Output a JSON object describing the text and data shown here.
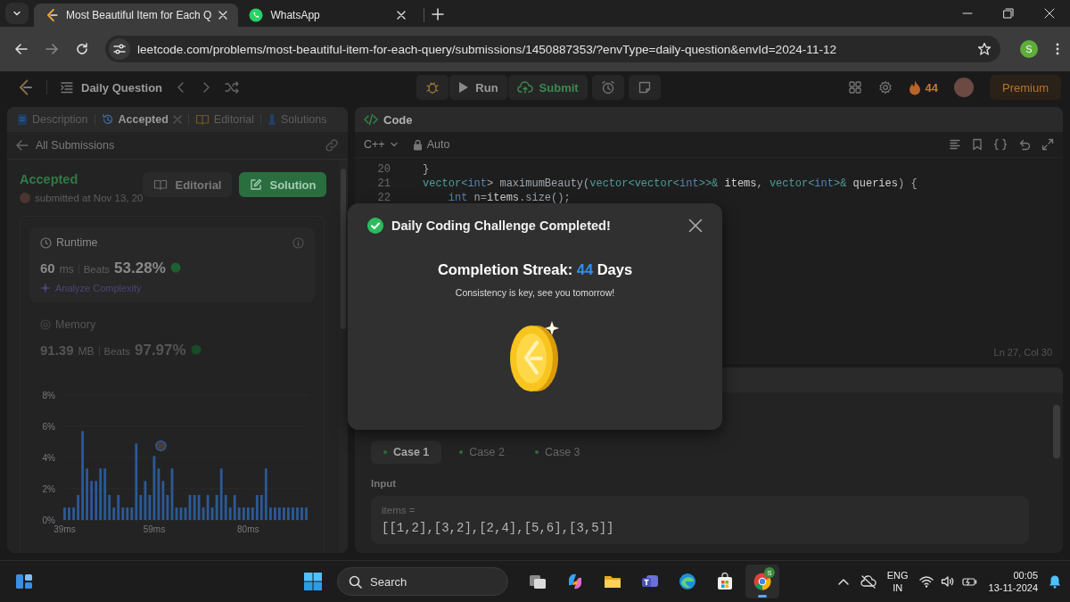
{
  "browser": {
    "tabs": [
      {
        "title": "Most Beautiful Item for Each Q",
        "kind": "leetcode",
        "selected": true
      },
      {
        "title": "WhatsApp",
        "kind": "chat",
        "selected": false
      }
    ],
    "url": "leetcode.com/problems/most-beautiful-item-for-each-query/submissions/1450887353/?envType=daily-question&envId=2024-11-12",
    "profile_initial": "S"
  },
  "nav": {
    "daily_question": "Daily Question",
    "run": "Run",
    "submit": "Submit",
    "streak": "44",
    "premium": "Premium"
  },
  "left_panel": {
    "tabs": [
      {
        "label": "Description",
        "selected": false,
        "closable": false
      },
      {
        "label": "Accepted",
        "selected": true,
        "closable": true
      },
      {
        "label": "Editorial",
        "selected": false,
        "closable": false
      },
      {
        "label": "Solutions",
        "selected": false,
        "closable": false
      }
    ],
    "back_link": "All Submissions",
    "status": "Accepted",
    "submitted": "submitted at Nov 13, 20",
    "buttons": [
      {
        "label": "Editorial",
        "kind": "secondary"
      },
      {
        "label": "Solution",
        "kind": "primary"
      }
    ],
    "runtime": {
      "title": "Runtime",
      "value": "60",
      "unit": "ms",
      "beats_label": "Beats",
      "beats": "53.28%",
      "analyze": "Analyze Complexity"
    },
    "memory": {
      "title": "Memory",
      "value": "91.39",
      "unit": "MB",
      "beats_label": "Beats",
      "beats": "97.97%"
    },
    "chart_data": {
      "type": "bar",
      "ylim": [
        0,
        8
      ],
      "values": [
        0.8,
        0.8,
        0.8,
        1.6,
        5.7,
        3.3,
        2.5,
        2.5,
        3.3,
        3.3,
        1.6,
        0.8,
        1.6,
        0.8,
        0.8,
        0.8,
        4.9,
        1.6,
        2.5,
        1.6,
        4.1,
        3.3,
        2.5,
        1.6,
        3.3,
        0.8,
        0.8,
        0.8,
        1.6,
        1.6,
        1.6,
        0.8,
        1.6,
        0.8,
        1.6,
        3.3,
        1.6,
        0.8,
        1.6,
        0.8,
        0.8,
        0.8,
        0.8,
        1.6,
        1.6,
        3.3,
        0.8,
        0.8,
        0.8,
        0.8,
        0.8,
        0.8,
        0.8,
        0.8,
        0.8
      ],
      "yticks": [
        {
          "value": 0,
          "label": "0%"
        },
        {
          "value": 2,
          "label": "2%"
        },
        {
          "value": 4,
          "label": "4%"
        },
        {
          "value": 6,
          "label": "6%"
        },
        {
          "value": 8,
          "label": "8%"
        }
      ],
      "x": [
        39,
        40,
        41,
        42,
        43,
        44,
        45,
        46,
        47,
        48,
        49,
        50,
        51,
        52,
        53,
        54,
        55,
        56,
        57,
        58,
        59,
        60,
        61,
        62,
        63,
        64,
        65,
        66,
        67,
        68,
        69,
        70,
        71,
        72,
        73,
        74,
        75,
        76,
        77,
        78,
        79,
        80,
        81,
        82,
        83,
        84,
        85,
        86,
        87,
        88,
        89,
        90,
        91,
        92,
        93
      ],
      "xticks": [
        {
          "value": 39,
          "label": "39ms"
        },
        {
          "value": 59,
          "label": "59ms"
        },
        {
          "value": 80,
          "label": "80ms"
        }
      ],
      "xlim": [
        38.5,
        93.5
      ]
    }
  },
  "code": {
    "title": "Code",
    "language": "C++",
    "mode": "Auto",
    "cursor": "Ln 27, Col 30",
    "lines": [
      {
        "number": "20",
        "tokens": [
          {
            "text": "}",
            "kind": "plain"
          }
        ]
      },
      {
        "number": "21",
        "tokens": [
          {
            "text": "vector<",
            "kind": "type"
          },
          {
            "text": "int",
            "kind": "keyword"
          },
          {
            "text": "> maximumBeauty(",
            "kind": "plain"
          },
          {
            "text": "vector<vector<",
            "kind": "type"
          },
          {
            "text": "int",
            "kind": "keyword"
          },
          {
            "text": ">>& ",
            "kind": "type"
          },
          {
            "text": "items",
            "kind": "param"
          },
          {
            "text": ", ",
            "kind": "plain"
          },
          {
            "text": "vector<",
            "kind": "type"
          },
          {
            "text": "int",
            "kind": "keyword"
          },
          {
            "text": ">& ",
            "kind": "type"
          },
          {
            "text": "queries",
            "kind": "param"
          },
          {
            "text": ") {",
            "kind": "plain"
          }
        ]
      },
      {
        "number": "22",
        "tokens": [
          {
            "text": "    int",
            "kind": "keyword"
          },
          {
            "text": " n=",
            "kind": "plain"
          },
          {
            "text": "items",
            "kind": "param"
          },
          {
            "text": ".size();",
            "kind": "plain"
          }
        ]
      }
    ]
  },
  "testcase": {
    "cases": [
      {
        "label": "Case 1",
        "selected": true
      },
      {
        "label": "Case 2",
        "selected": false
      },
      {
        "label": "Case 3",
        "selected": false
      }
    ],
    "input_label": "Input",
    "param": "items =",
    "value": "[[1,2],[3,2],[2,4],[5,6],[3,5]]"
  },
  "modal": {
    "title": "Daily Coding Challenge Completed!",
    "streak_label": "Completion Streak:",
    "streak": "44",
    "streak_unit": "Days",
    "message": "Consistency is key, see you tomorrow!"
  },
  "taskbar": {
    "search": "Search",
    "apps": [
      {
        "kind": "taskview",
        "active": false
      },
      {
        "kind": "copilot",
        "active": false
      },
      {
        "kind": "files",
        "active": false
      },
      {
        "kind": "teams",
        "active": false
      },
      {
        "kind": "edge",
        "active": false
      },
      {
        "kind": "store",
        "active": false
      },
      {
        "kind": "chrome",
        "active": true,
        "badge": "S"
      }
    ],
    "language": "ENG",
    "region": "IN",
    "time": "00:05",
    "date": "13-11-2024"
  }
}
